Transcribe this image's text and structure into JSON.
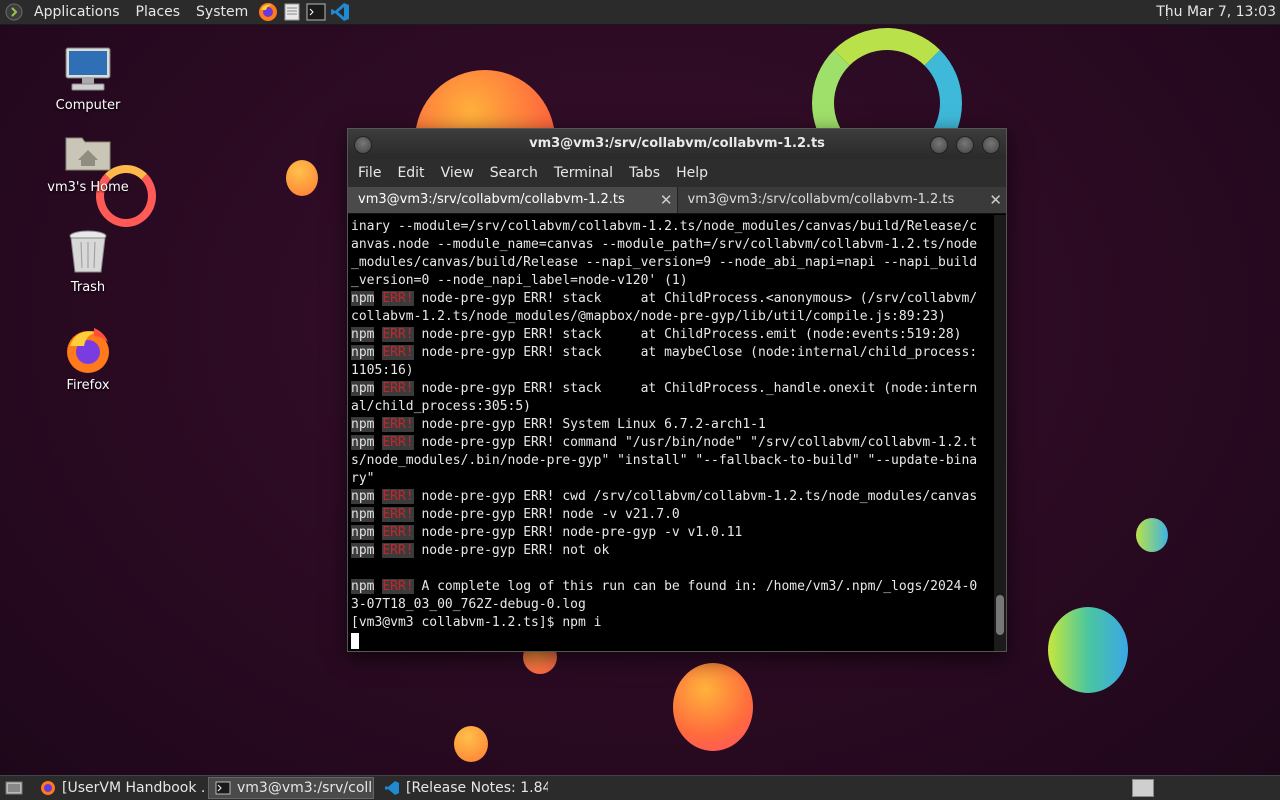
{
  "top_panel": {
    "menus": [
      "Applications",
      "Places",
      "System"
    ],
    "launchers": [
      "firefox-icon",
      "text-editor-icon",
      "terminal-icon",
      "vscode-icon"
    ],
    "clock": "Thu Mar  7, 13:03"
  },
  "desktop": {
    "icons": [
      {
        "label": "Computer",
        "icon": "computer-icon"
      },
      {
        "label": "vm3's Home",
        "icon": "home-folder-icon"
      },
      {
        "label": "Trash",
        "icon": "trash-icon"
      },
      {
        "label": "Firefox",
        "icon": "firefox-icon"
      }
    ]
  },
  "terminal": {
    "title": "vm3@vm3:/srv/collabvm/collabvm-1.2.ts",
    "menu": [
      "File",
      "Edit",
      "View",
      "Search",
      "Terminal",
      "Tabs",
      "Help"
    ],
    "tabs": [
      {
        "label": "vm3@vm3:/srv/collabvm/collabvm-1.2.ts",
        "active": true
      },
      {
        "label": "vm3@vm3:/srv/collabvm/collabvm-1.2.ts",
        "active": false
      }
    ],
    "lines": [
      {
        "npm": "",
        "err": "",
        "text": "inary --module=/srv/collabvm/collabvm-1.2.ts/node_modules/canvas/build/Release/c"
      },
      {
        "npm": "",
        "err": "",
        "text": "anvas.node --module_name=canvas --module_path=/srv/collabvm/collabvm-1.2.ts/node"
      },
      {
        "npm": "",
        "err": "",
        "text": "_modules/canvas/build/Release --napi_version=9 --node_abi_napi=napi --napi_build"
      },
      {
        "npm": "",
        "err": "",
        "text": "_version=0 --node_napi_label=node-v120' (1)"
      },
      {
        "npm": "npm",
        "err": "ERR!",
        "text": " node-pre-gyp ERR! stack     at ChildProcess.<anonymous> (/srv/collabvm/"
      },
      {
        "npm": "",
        "err": "",
        "text": "collabvm-1.2.ts/node_modules/@mapbox/node-pre-gyp/lib/util/compile.js:89:23)"
      },
      {
        "npm": "npm",
        "err": "ERR!",
        "text": " node-pre-gyp ERR! stack     at ChildProcess.emit (node:events:519:28)"
      },
      {
        "npm": "npm",
        "err": "ERR!",
        "text": " node-pre-gyp ERR! stack     at maybeClose (node:internal/child_process:"
      },
      {
        "npm": "",
        "err": "",
        "text": "1105:16)"
      },
      {
        "npm": "npm",
        "err": "ERR!",
        "text": " node-pre-gyp ERR! stack     at ChildProcess._handle.onexit (node:intern"
      },
      {
        "npm": "",
        "err": "",
        "text": "al/child_process:305:5)"
      },
      {
        "npm": "npm",
        "err": "ERR!",
        "text": " node-pre-gyp ERR! System Linux 6.7.2-arch1-1"
      },
      {
        "npm": "npm",
        "err": "ERR!",
        "text": " node-pre-gyp ERR! command \"/usr/bin/node\" \"/srv/collabvm/collabvm-1.2.t"
      },
      {
        "npm": "",
        "err": "",
        "text": "s/node_modules/.bin/node-pre-gyp\" \"install\" \"--fallback-to-build\" \"--update-bina"
      },
      {
        "npm": "",
        "err": "",
        "text": "ry\""
      },
      {
        "npm": "npm",
        "err": "ERR!",
        "text": " node-pre-gyp ERR! cwd /srv/collabvm/collabvm-1.2.ts/node_modules/canvas"
      },
      {
        "npm": "npm",
        "err": "ERR!",
        "text": " node-pre-gyp ERR! node -v v21.7.0"
      },
      {
        "npm": "npm",
        "err": "ERR!",
        "text": " node-pre-gyp ERR! node-pre-gyp -v v1.0.11"
      },
      {
        "npm": "npm",
        "err": "ERR!",
        "text": " node-pre-gyp ERR! not ok"
      },
      {
        "npm": "",
        "err": "",
        "text": ""
      },
      {
        "npm": "npm",
        "err": "ERR!",
        "text": " A complete log of this run can be found in: /home/vm3/.npm/_logs/2024-0"
      },
      {
        "npm": "",
        "err": "",
        "text": "3-07T18_03_00_762Z-debug-0.log"
      },
      {
        "npm": "",
        "err": "",
        "text": "[vm3@vm3 collabvm-1.2.ts]$ npm i"
      }
    ]
  },
  "taskbar": {
    "items": [
      {
        "label": "[UserVM Handbook ...",
        "icon": "firefox-icon",
        "active": false
      },
      {
        "label": "vm3@vm3:/srv/coll...",
        "icon": "terminal-icon",
        "active": true
      },
      {
        "label": "[Release Notes: 1.84...",
        "icon": "vscode-icon",
        "active": false
      }
    ]
  }
}
